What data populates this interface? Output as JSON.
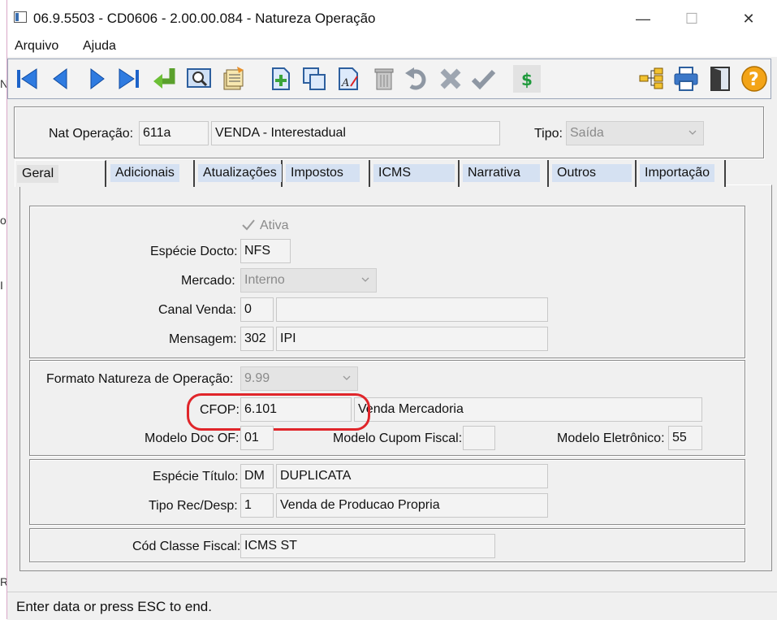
{
  "window": {
    "title": "06.9.5503 - CD0606 - 2.00.00.084 - Natureza Operação",
    "minimize_glyph": "—",
    "maximize_glyph": "☐",
    "close_glyph": "✕"
  },
  "background_chars": [
    "N",
    "o",
    "I",
    "R"
  ],
  "menu": {
    "items": [
      "Arquivo",
      "Ajuda"
    ]
  },
  "toolbar": {
    "icons": [
      "first-record-icon",
      "previous-record-icon",
      "next-record-icon",
      "last-record-icon",
      "go-to-icon",
      "search-icon",
      "list-icon",
      "new-record-icon",
      "copy-icon",
      "edit-icon",
      "delete-icon",
      "undo-icon",
      "cancel-icon",
      "save-icon",
      "price-icon",
      "tree-icon",
      "print-icon",
      "exit-icon",
      "help-icon"
    ],
    "help_glyph": "?",
    "price_glyph": "$"
  },
  "header": {
    "nat_label": "Nat Operação:",
    "nat_code": "611a",
    "nat_desc": "VENDA - Interestadual",
    "tipo_label": "Tipo:",
    "tipo_value": "Saída"
  },
  "tabs": [
    "Geral",
    "Adicionais",
    "Atualizações",
    "Impostos",
    "ICMS",
    "Narrativa",
    "Outros",
    "Importação"
  ],
  "geral": {
    "ativa_label": "Ativa",
    "especie_docto_label": "Espécie Docto:",
    "especie_docto": "NFS",
    "mercado_label": "Mercado:",
    "mercado": "Interno",
    "canal_venda_label": "Canal Venda:",
    "canal_venda_code": "0",
    "canal_venda_desc": "",
    "mensagem_label": "Mensagem:",
    "mensagem_code": "302",
    "mensagem_desc": "IPI",
    "formato_label": "Formato Natureza de Operação:",
    "formato": "9.99",
    "cfop_label": "CFOP:",
    "cfop_code": "6.101",
    "cfop_desc": "Venda Mercadoria",
    "modelo_doc_label": "Modelo Doc OF:",
    "modelo_doc": "01",
    "modelo_cupom_label": "Modelo Cupom Fiscal:",
    "modelo_cupom": "",
    "modelo_eletronico_label": "Modelo Eletrônico:",
    "modelo_eletronico": "55",
    "especie_titulo_label": "Espécie Título:",
    "especie_titulo_code": "DM",
    "especie_titulo_desc": "DUPLICATA",
    "tipo_rec_label": "Tipo Rec/Desp:",
    "tipo_rec_code": "1",
    "tipo_rec_desc": "Venda de Producao Propria",
    "cod_classe_label": "Cód Classe Fiscal:",
    "cod_classe": "ICMS ST"
  },
  "status": {
    "text": "Enter data or press ESC to end."
  },
  "colors": {
    "highlight": "#e0252a",
    "tab_bg": "#d5e1f2",
    "toolbar_border": "#9aa5b8"
  }
}
